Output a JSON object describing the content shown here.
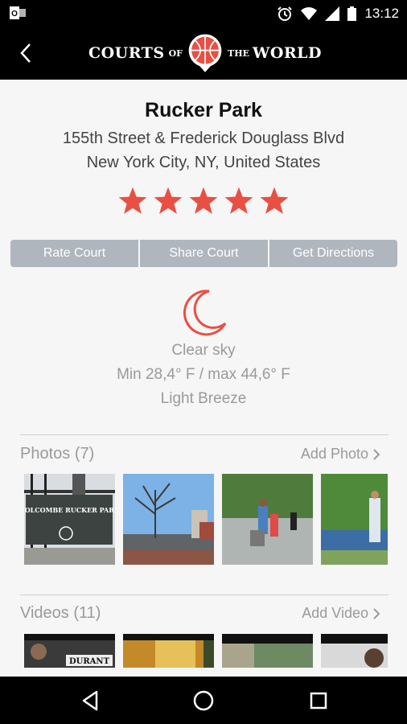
{
  "status_bar": {
    "time": "13:12"
  },
  "header": {
    "logo": {
      "word1": "COURTS",
      "word2": "OF",
      "word3": "THE",
      "word4": "WORLD"
    }
  },
  "court": {
    "name": "Rucker Park",
    "address_line1": "155th Street & Frederick Douglass Blvd",
    "address_line2": "New York City, NY, United States",
    "rating": 5
  },
  "actions": {
    "rate": "Rate Court",
    "share": "Share Court",
    "directions": "Get Directions"
  },
  "weather": {
    "icon": "moon-icon",
    "condition": "Clear sky",
    "temperature": "Min 28,4° F / max 44,6° F",
    "wind": "Light Breeze"
  },
  "photos": {
    "title": "Photos (7)",
    "add_label": "Add Photo",
    "sign_text": "HOLCOMBE RUCKER PARK"
  },
  "videos": {
    "title": "Videos (11)",
    "add_label": "Add Video",
    "caption_text": "DURANT"
  },
  "colors": {
    "accent": "#ea4f43",
    "button": "#b0b6be",
    "background": "#f6f6f6",
    "bar": "#000000"
  }
}
